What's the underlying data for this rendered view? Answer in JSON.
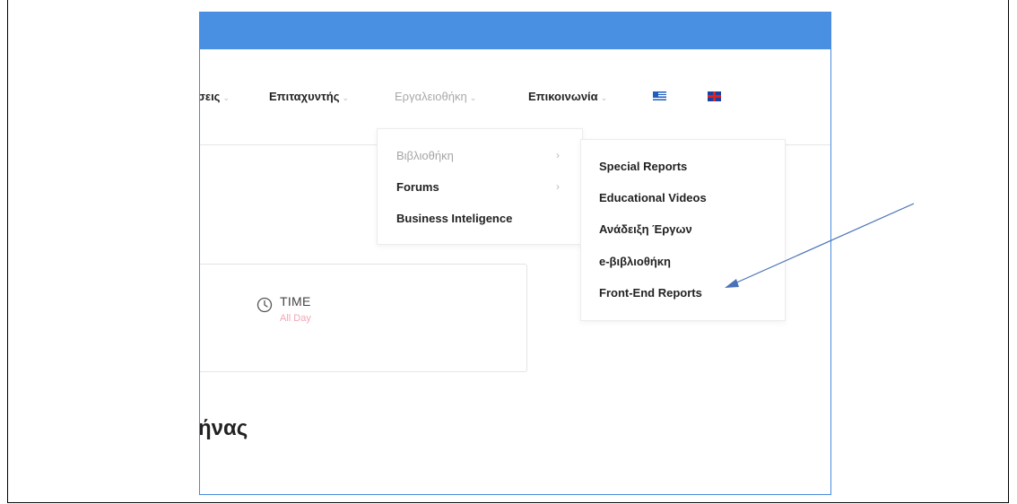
{
  "nav": {
    "items": [
      {
        "label": "σεις",
        "active": false
      },
      {
        "label": "Επιταχυντής",
        "active": false
      },
      {
        "label": "Εργαλειοθήκη",
        "active": true
      },
      {
        "label": "Επικοινωνία",
        "active": false
      }
    ],
    "languages": [
      {
        "name": "greek-flag-icon"
      },
      {
        "name": "uk-flag-icon"
      }
    ]
  },
  "menu_level1": {
    "items": [
      "Βιβλιοθήκη",
      "Forums",
      "Business Inteligence"
    ],
    "active_item": "Βιβλιοθήκη"
  },
  "menu_level2": {
    "items": [
      "Special Reports",
      "Educational Videos",
      "Ανάδειξη Έργων",
      "e-βιβλιοθήκη",
      "Front-End Reports"
    ]
  },
  "event": {
    "time_label": "TIME",
    "time_value": "All Day"
  },
  "heading": "ήνας",
  "colors": {
    "topbar": "#4a90e2",
    "frame_border": "#4a89dc",
    "arrow": "#4a72b8",
    "time_value": "#f1a7b6"
  },
  "icons": [
    "chevron-down-icon",
    "chevron-right-icon",
    "clock-icon",
    "annotation-arrow"
  ]
}
